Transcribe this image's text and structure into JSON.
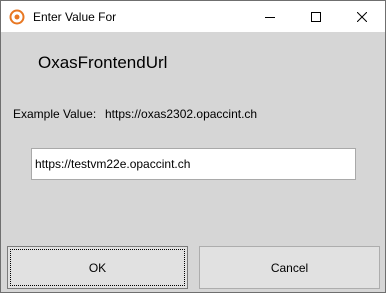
{
  "window": {
    "title": "Enter Value For",
    "controls": {
      "minimize_icon": "minimize-icon",
      "maximize_icon": "maximize-icon",
      "close_icon": "close-icon"
    },
    "app_icon": "app-icon",
    "accent_color": "#e87722"
  },
  "dialog": {
    "heading": "OxasFrontendUrl",
    "example_label": "Example Value:",
    "example_value": "https://oxas2302.opaccint.ch",
    "input_value": "https://testvm22e.opaccint.ch",
    "ok_label": "OK",
    "cancel_label": "Cancel"
  }
}
